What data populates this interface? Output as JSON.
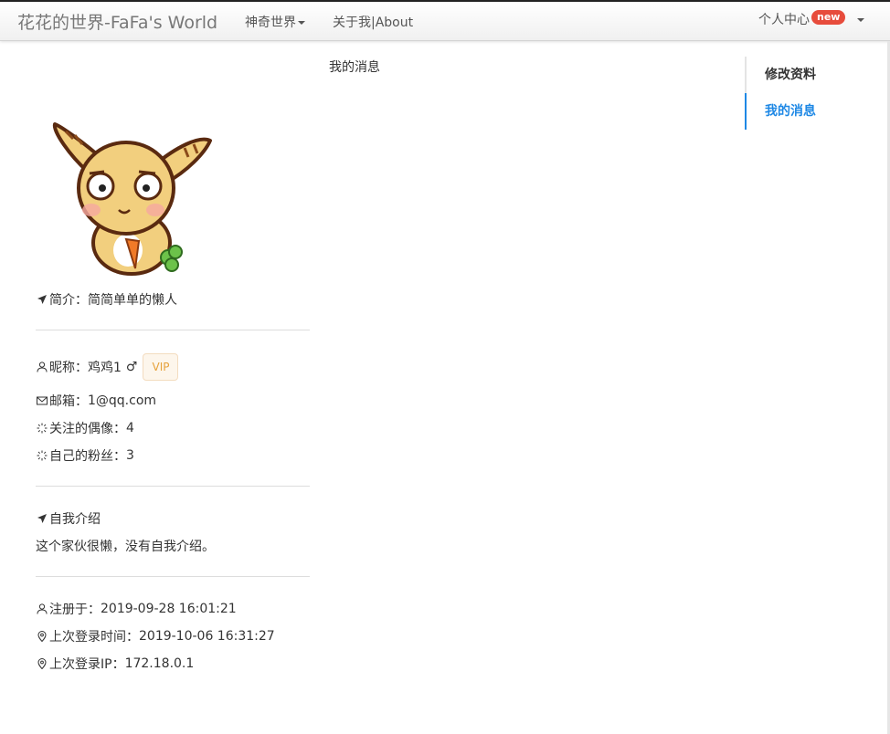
{
  "nav": {
    "brand": "花花的世界-FaFa's World",
    "menu_magic": "神奇世界",
    "menu_about": "关于我|About",
    "user_center": "个人中心",
    "new_badge": "new"
  },
  "profile": {
    "intro_label": "简介：",
    "intro_value": "简简单单的懒人",
    "nickname_label": "昵称：",
    "nickname_value": "鸡鸡1",
    "gender_symbol": "♂",
    "vip_label": "VIP",
    "email_label": "邮箱：",
    "email_value": "1@qq.com",
    "following_label": "关注的偶像：",
    "following_value": "4",
    "fans_label": "自己的粉丝：",
    "fans_value": "3",
    "self_intro_title": "自我介绍",
    "self_intro_text": "这个家伙很懒，没有自我介绍。",
    "registered_label": "注册于：",
    "registered_value": "2019-09-28 16:01:21",
    "last_login_label": "上次登录时间：",
    "last_login_value": "2019-10-06 16:31:27",
    "last_ip_label": "上次登录IP：",
    "last_ip_value": "172.18.0.1"
  },
  "main": {
    "title": "我的消息"
  },
  "side_menu": {
    "items": [
      {
        "label": "修改资料",
        "active": false
      },
      {
        "label": "我的消息",
        "active": true
      }
    ]
  },
  "colors": {
    "accent": "#1e88e5",
    "badge": "#e74c3c",
    "vip_text": "#e6a23c"
  }
}
